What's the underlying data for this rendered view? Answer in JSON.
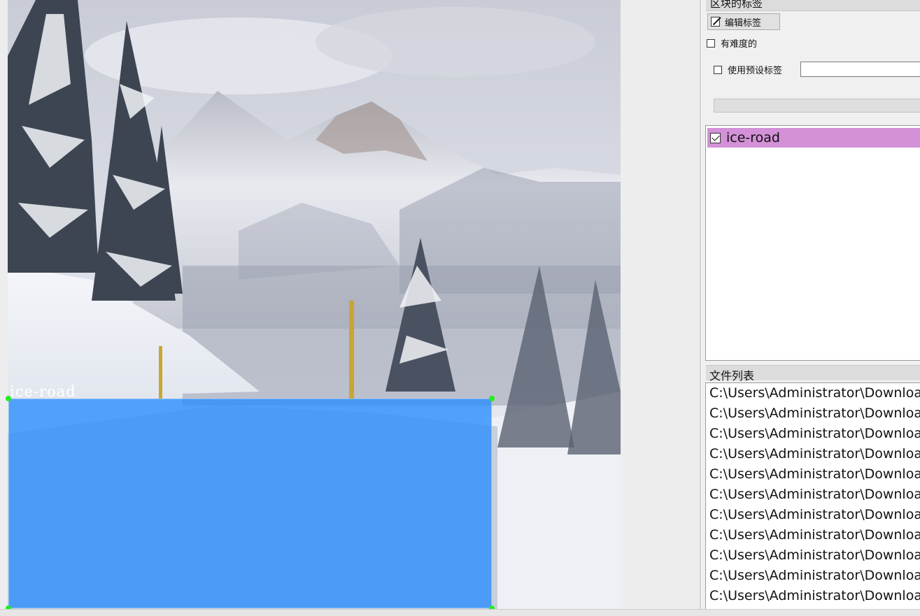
{
  "canvas": {
    "box_label": "ice-road",
    "box_color": "#288cff",
    "handle_color": "#22ee22",
    "image_description_icon": "snowy-mountain-road-photo"
  },
  "dock": {
    "title": "区块的标签",
    "edit_button_label": "编辑标签",
    "edit_icon": "edit-icon",
    "difficult_label": "有难度的",
    "difficult_checked": false,
    "preset_label": "使用预设标签",
    "preset_checked": false,
    "preset_value": "",
    "labels": [
      {
        "text": "ice-road",
        "checked": true,
        "color": "#d391d8"
      }
    ]
  },
  "file_panel": {
    "title": "文件列表",
    "files": [
      "C:\\Users\\Administrator\\Downloa",
      "C:\\Users\\Administrator\\Downloa",
      "C:\\Users\\Administrator\\Downloa",
      "C:\\Users\\Administrator\\Downloa",
      "C:\\Users\\Administrator\\Downloa",
      "C:\\Users\\Administrator\\Downloa",
      "C:\\Users\\Administrator\\Downloa",
      "C:\\Users\\Administrator\\Downloa",
      "C:\\Users\\Administrator\\Downloa",
      "C:\\Users\\Administrator\\Downloa",
      "C:\\Users\\Administrator\\Downloa"
    ]
  }
}
